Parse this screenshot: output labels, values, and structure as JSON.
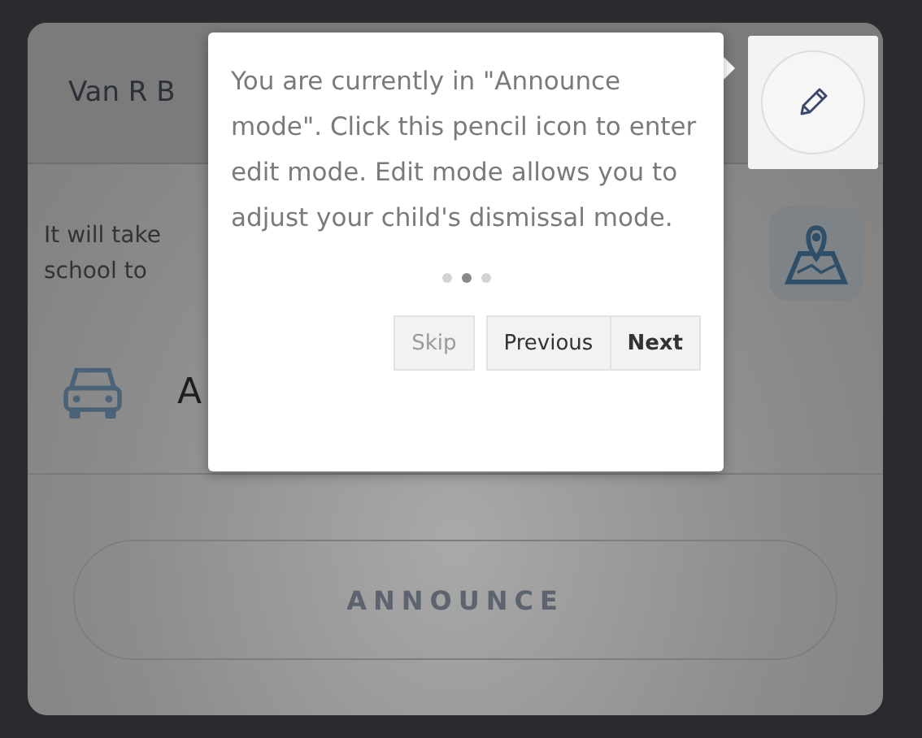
{
  "card": {
    "title": "Van R B",
    "message_lines": [
      "It will take",
      "school to"
    ],
    "mode_label": "A",
    "announce_button": "ANNOUNCE"
  },
  "tour": {
    "text": "You are currently in \"Announce mode\". Click this pencil icon to enter edit mode. Edit mode allows you to adjust your child's dismissal mode.",
    "steps": [
      {
        "selected": false
      },
      {
        "selected": true
      },
      {
        "selected": false
      }
    ],
    "buttons": [
      {
        "label": "Skip",
        "kind": "skip"
      },
      {
        "label": "Previous",
        "kind": "previous"
      },
      {
        "label": "Next",
        "kind": "next"
      }
    ]
  }
}
